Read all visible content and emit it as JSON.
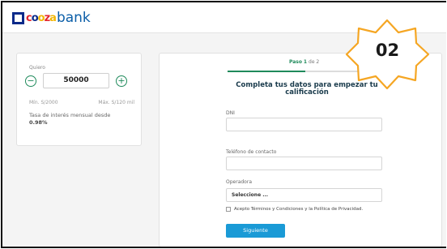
{
  "brand": {
    "logo_mark": "cooza",
    "logo_text": "bank",
    "primary_color": "#0b2a8a",
    "accent_color": "#1f8a5b",
    "button_color": "#1a9ad6"
  },
  "loan": {
    "label": "Quiero",
    "amount": "50000",
    "decrement_icon": "minus-icon",
    "increment_icon": "plus-icon",
    "min_label": "Mín. S/2000",
    "max_label": "Máx. S/120 mil",
    "rate_label": "Tasa de interés mensual desde",
    "rate_value": "0.98%"
  },
  "form": {
    "step_prefix": "Paso",
    "step_current": "1",
    "step_suffix": "de 2",
    "step_progress": 0.5,
    "title": "Completa tus datos para empezar tu calificación",
    "dni_label": "DNI",
    "dni_value": "",
    "phone_label": "Teléfono de contacto",
    "phone_value": "",
    "operator_label": "Operadora",
    "operator_selected": "Seleccione ...",
    "terms_text": "Acepto Términos y Condiciones y la Política de Privacidad.",
    "terms_checked": false,
    "submit_label": "Siguiente"
  },
  "annotation": {
    "badge_number": "02",
    "badge_color": "#f5a623"
  }
}
